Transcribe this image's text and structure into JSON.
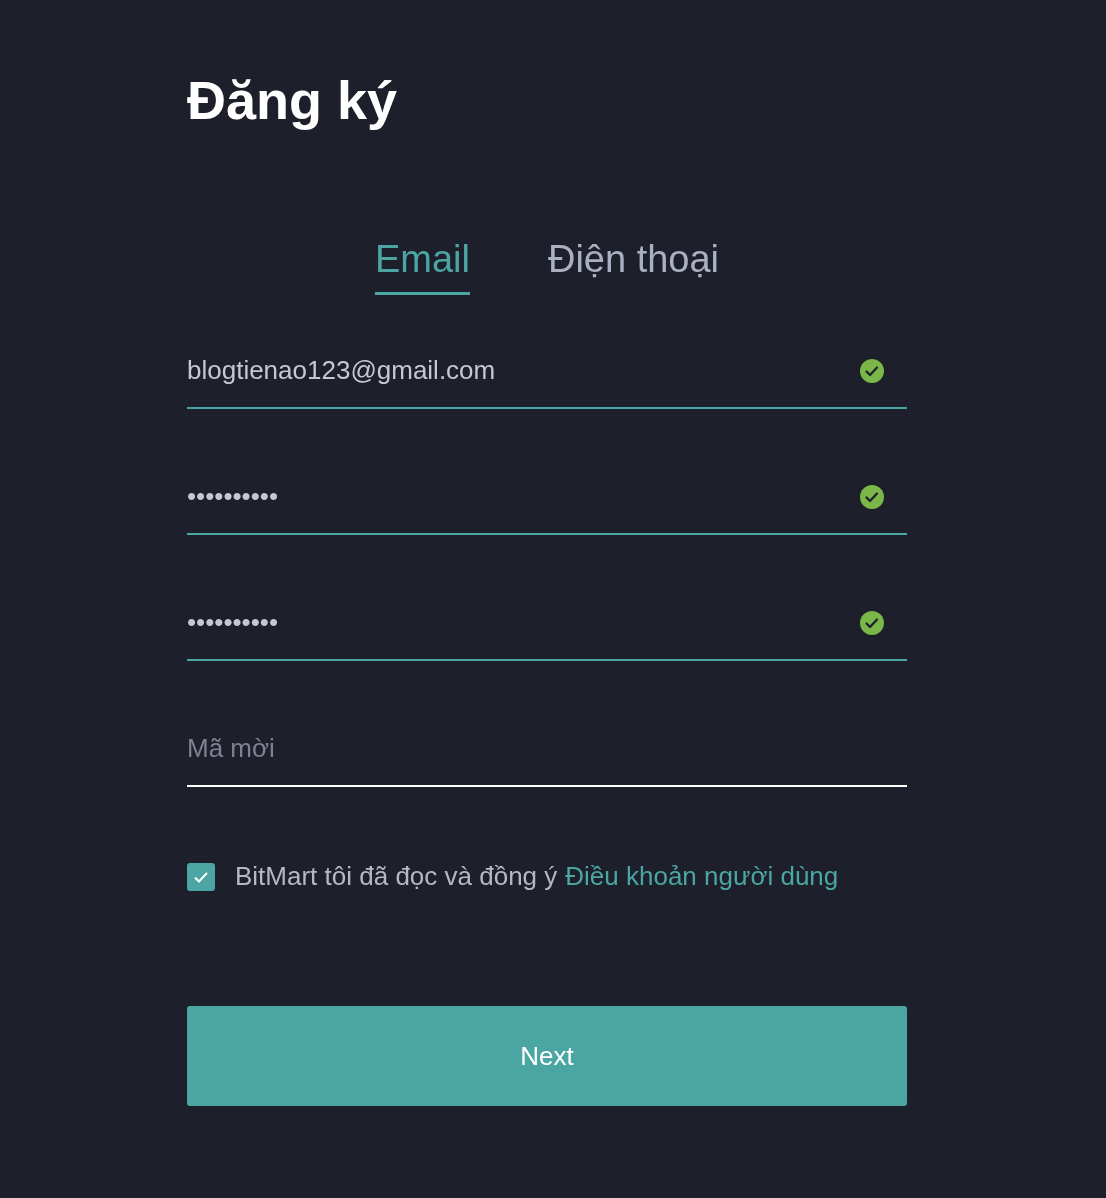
{
  "title": "Đăng ký",
  "tabs": [
    {
      "label": "Email",
      "selected": true
    },
    {
      "label": "Điện thoại",
      "selected": false
    }
  ],
  "fields": [
    {
      "value": "blogtienao123@gmail.com",
      "valid": true
    },
    {
      "value": "••••••••••",
      "valid": true
    },
    {
      "value": "••••••••••",
      "valid": true
    },
    {
      "placeholder": "Mã mời",
      "valid": false
    }
  ],
  "agreement": {
    "checked": true,
    "text": "BitMart tôi đã đọc và đồng ý",
    "link": "Điều khoản người dùng"
  },
  "button": "Next"
}
